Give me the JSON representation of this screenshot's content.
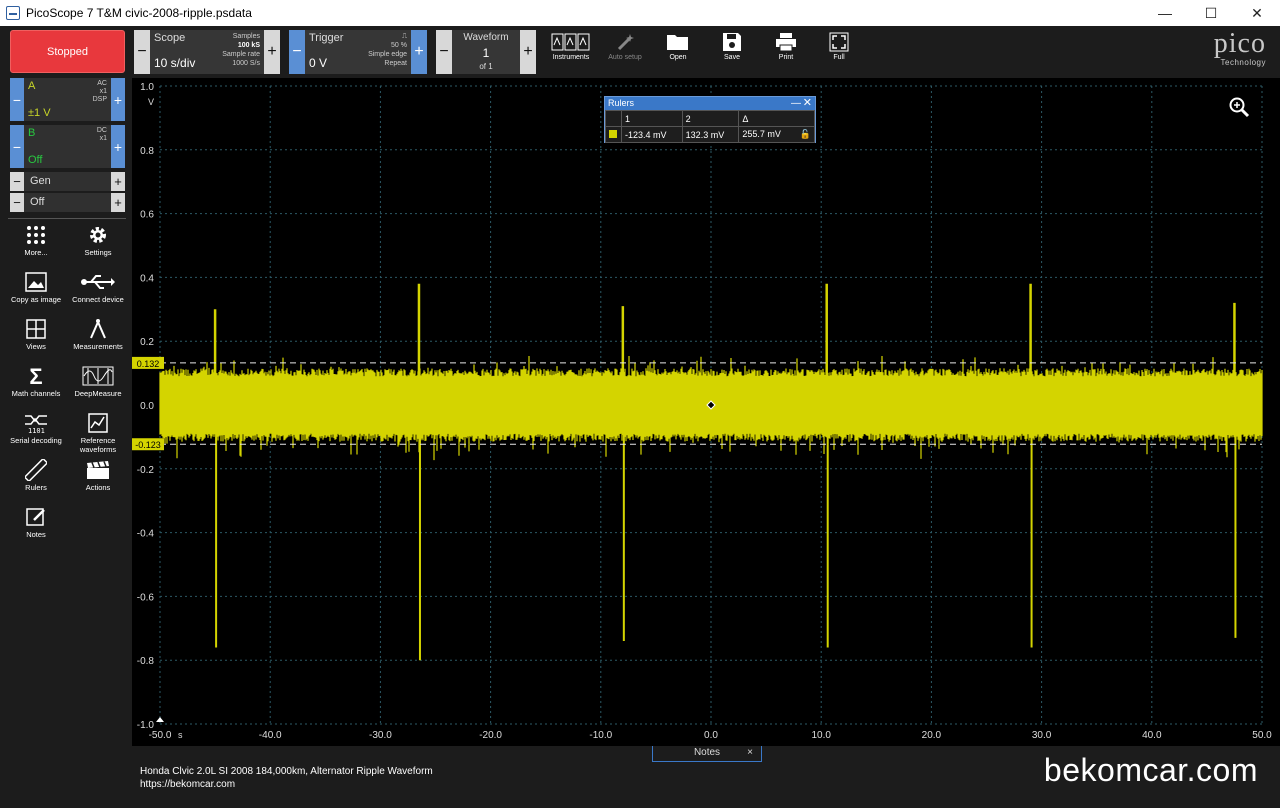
{
  "window": {
    "title": "PicoScope 7 T&M civic-2008-ripple.psdata",
    "min": "—",
    "max": "☐",
    "close": "✕"
  },
  "toolbar": {
    "stop_label": "Stopped",
    "scope": {
      "label": "Scope",
      "value": "10 s/div",
      "samples_label": "Samples",
      "samples": "100 kS",
      "rate_label": "Sample rate",
      "rate": "1000 S/s"
    },
    "trigger": {
      "label": "Trigger",
      "value": "0 V",
      "edge_glyph": "⎍",
      "percent": "50 %",
      "type": "Simple edge",
      "mode": "Repeat"
    },
    "waveform": {
      "label": "Waveform",
      "index": "1",
      "of": "of 1"
    },
    "tools": [
      {
        "name": "instruments",
        "label": "Instruments"
      },
      {
        "name": "auto-setup",
        "label": "Auto setup"
      },
      {
        "name": "open",
        "label": "Open"
      },
      {
        "name": "save",
        "label": "Save"
      },
      {
        "name": "print",
        "label": "Print"
      },
      {
        "name": "full",
        "label": "Full"
      }
    ],
    "logo": {
      "big": "pico",
      "small": "Technology"
    }
  },
  "channels": {
    "a": {
      "name": "A",
      "range": "±1 V",
      "coupling": "AC",
      "probe": "x1",
      "extra": "DSP"
    },
    "b": {
      "name": "B",
      "range": "Off",
      "coupling": "DC",
      "probe": "x1"
    },
    "gen": {
      "label": "Gen",
      "state": "Off"
    }
  },
  "sidebar_buttons": [
    {
      "name": "more",
      "label": "More..."
    },
    {
      "name": "settings",
      "label": "Settings"
    },
    {
      "name": "copy-as-image",
      "label": "Copy as image"
    },
    {
      "name": "connect-device",
      "label": "Connect device"
    },
    {
      "name": "views",
      "label": "Views"
    },
    {
      "name": "measurements",
      "label": "Measurements"
    },
    {
      "name": "math-channels",
      "label": "Math channels"
    },
    {
      "name": "deepmeasure",
      "label": "DeepMeasure"
    },
    {
      "name": "serial-decoding",
      "label": "Serial decoding"
    },
    {
      "name": "reference-waveforms",
      "label": "Reference waveforms"
    },
    {
      "name": "rulers",
      "label": "Rulers"
    },
    {
      "name": "actions",
      "label": "Actions"
    },
    {
      "name": "notes",
      "label": "Notes"
    }
  ],
  "rulers_panel": {
    "title": "Rulers",
    "col1": "1",
    "col2": "2",
    "col3": "Δ",
    "v1": "-123.4 mV",
    "v2": "132.3 mV",
    "delta": "255.7 mV"
  },
  "chart_data": {
    "type": "line",
    "y_unit": "V",
    "x_unit": "s",
    "ylim": [
      -1.0,
      1.0
    ],
    "xlim": [
      -50.0,
      50.0
    ],
    "y_ticks": [
      "1.0",
      "0.8",
      "0.6",
      "0.4",
      "0.2",
      "0.0",
      "-0.2",
      "-0.4",
      "-0.6",
      "-0.8",
      "-1.0"
    ],
    "x_ticks": [
      "-50.0",
      "-40.0",
      "-30.0",
      "-20.0",
      "-10.0",
      "0.0",
      "10.0",
      "20.0",
      "30.0",
      "40.0",
      "50.0"
    ],
    "grid": true,
    "series_color": "#d4d400",
    "ruler_lines": [
      {
        "label": "0.132",
        "value": 0.132
      },
      {
        "label": "-0.123",
        "value": -0.123
      }
    ],
    "band_upper": 0.09,
    "band_lower": -0.09,
    "spikes": [
      {
        "x": -45.0,
        "max": 0.3,
        "min": -0.76
      },
      {
        "x": -26.5,
        "max": 0.38,
        "min": -0.8
      },
      {
        "x": -8.0,
        "max": 0.31,
        "min": -0.74
      },
      {
        "x": 10.5,
        "max": 0.38,
        "min": -0.76
      },
      {
        "x": 29.0,
        "max": 0.38,
        "min": -0.76
      },
      {
        "x": 47.5,
        "max": 0.32,
        "min": -0.73
      }
    ]
  },
  "notes": {
    "tab_label": "Notes",
    "close": "×",
    "line1": "Honda Clvic 2.0L SI 2008 184,000km, Alternator Ripple Waveform",
    "line2": "https://bekomcar.com",
    "watermark": "bekomcar.com"
  }
}
